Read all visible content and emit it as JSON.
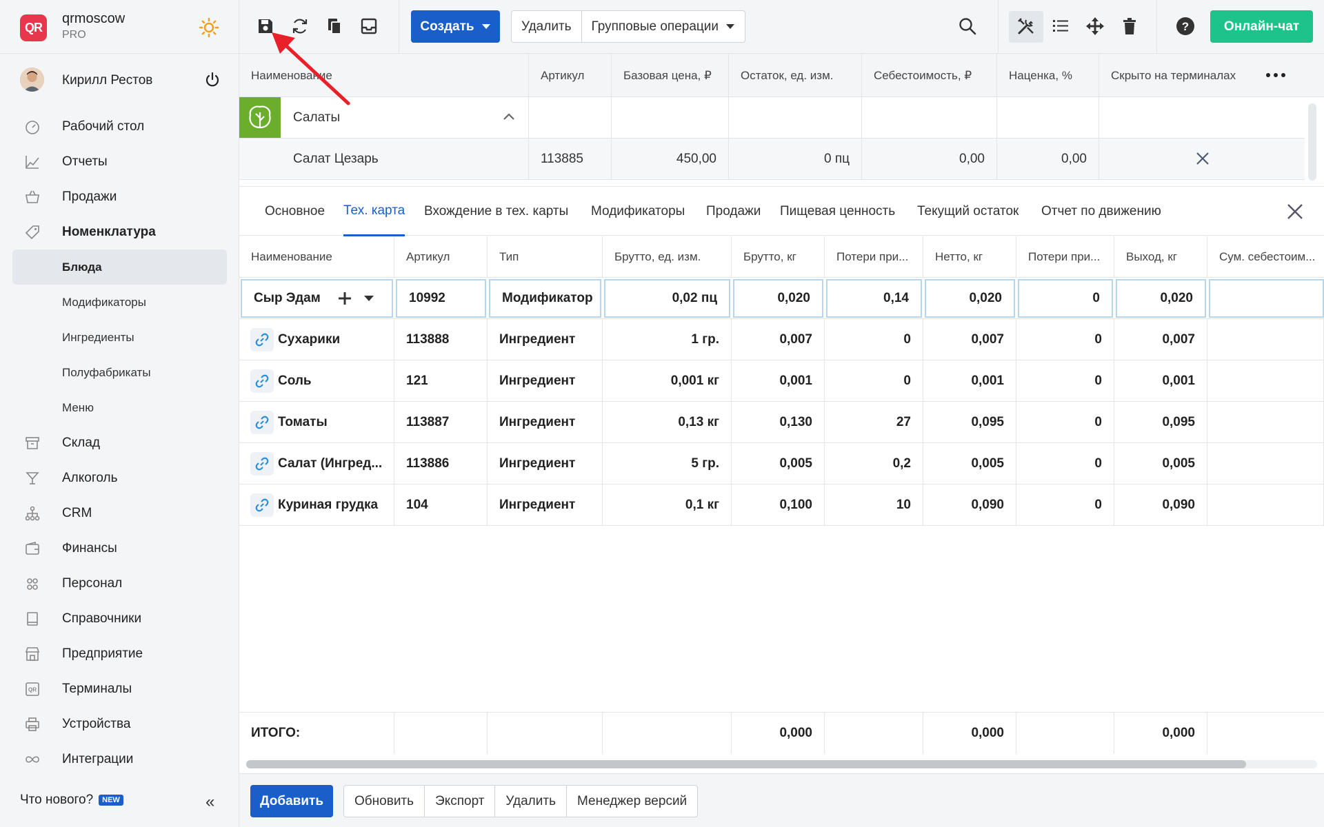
{
  "colors": {
    "accent": "#1a5fc9",
    "chat": "#1ec38b",
    "category": "#6aae2b",
    "logo": "#e8364c",
    "arrow": "#e8202a"
  },
  "brand": {
    "logo_text": "QR",
    "name": "qrmoscow",
    "plan": "PRO"
  },
  "user": {
    "name": "Кирилл Рестов"
  },
  "nav": {
    "items": [
      {
        "label": "Рабочий стол",
        "icon": "dashboard-icon"
      },
      {
        "label": "Отчеты",
        "icon": "chart-icon"
      },
      {
        "label": "Продажи",
        "icon": "basket-icon"
      },
      {
        "label": "Номенклатура",
        "icon": "tag-icon"
      },
      {
        "label": "Склад",
        "icon": "archive-icon"
      },
      {
        "label": "Алкоголь",
        "icon": "glass-icon"
      },
      {
        "label": "CRM",
        "icon": "hierarchy-icon"
      },
      {
        "label": "Финансы",
        "icon": "wallet-icon"
      },
      {
        "label": "Персонал",
        "icon": "people-icon"
      },
      {
        "label": "Справочники",
        "icon": "book-icon"
      },
      {
        "label": "Предприятие",
        "icon": "store-icon"
      },
      {
        "label": "Терминалы",
        "icon": "qr-icon"
      },
      {
        "label": "Устройства",
        "icon": "printer-icon"
      },
      {
        "label": "Интеграции",
        "icon": "infinity-icon"
      }
    ],
    "subitems": [
      "Блюда",
      "Модификаторы",
      "Ингредиенты",
      "Полуфабрикаты",
      "Меню"
    ],
    "whats_new": "Что нового?",
    "new_badge": "NEW"
  },
  "toolbar": {
    "create": "Создать",
    "delete": "Удалить",
    "group_ops": "Групповые операции",
    "chat": "Онлайн-чат"
  },
  "grid": {
    "headers": [
      "Наименование",
      "Артикул",
      "Базовая цена, ₽",
      "Остаток, ед. изм.",
      "Себестоимость, ₽",
      "Наценка, %",
      "Скрыто на терминалах"
    ],
    "category": "Салаты",
    "row": {
      "name": "Салат Цезарь",
      "article": "113885",
      "price": "450,00",
      "stock": "0 пц",
      "cost": "0,00",
      "markup": "0,00"
    }
  },
  "tabs": [
    "Основное",
    "Тех. карта",
    "Вхождение в тех. карты",
    "Модификаторы",
    "Продажи",
    "Пищевая ценность",
    "Текущий остаток",
    "Отчет по движению"
  ],
  "tech": {
    "headers": [
      "Наименование",
      "Артикул",
      "Тип",
      "Брутто, ед. изм.",
      "Брутто, кг",
      "Потери при...",
      "Нетто, кг",
      "Потери при...",
      "Выход, кг",
      "Сум. себестоим..."
    ],
    "edit_row": {
      "name": "Сыр Эдам",
      "article_ph": "10992",
      "type_ph": "Модификатор",
      "gross_unit": "0,02 пц",
      "gross_kg": "0,020",
      "loss1": "0,14",
      "net": "0,020",
      "loss2": "0",
      "yield": "0,020"
    },
    "rows": [
      {
        "name": "Сухарики",
        "article": "113888",
        "type": "Ингредиент",
        "gross_unit": "1 гр.",
        "gross_kg": "0,007",
        "loss1": "0",
        "net": "0,007",
        "loss2": "0",
        "yield": "0,007"
      },
      {
        "name": "Соль",
        "article": "121",
        "type": "Ингредиент",
        "gross_unit": "0,001 кг",
        "gross_kg": "0,001",
        "loss1": "0",
        "net": "0,001",
        "loss2": "0",
        "yield": "0,001"
      },
      {
        "name": "Томаты",
        "article": "113887",
        "type": "Ингредиент",
        "gross_unit": "0,13 кг",
        "gross_kg": "0,130",
        "loss1": "27",
        "net": "0,095",
        "loss2": "0",
        "yield": "0,095"
      },
      {
        "name": "Салат (Ингред...",
        "article": "113886",
        "type": "Ингредиент",
        "gross_unit": "5 гр.",
        "gross_kg": "0,005",
        "loss1": "0,2",
        "net": "0,005",
        "loss2": "0",
        "yield": "0,005"
      },
      {
        "name": "Куриная грудка",
        "article": "104",
        "type": "Ингредиент",
        "gross_unit": "0,1 кг",
        "gross_kg": "0,100",
        "loss1": "10",
        "net": "0,090",
        "loss2": "0",
        "yield": "0,090"
      }
    ],
    "total_label": "ИТОГО:",
    "total_gross_kg": "0,000",
    "total_net": "0,000",
    "total_yield": "0,000"
  },
  "bottom": {
    "add": "Добавить",
    "refresh": "Обновить",
    "export": "Экспорт",
    "delete": "Удалить",
    "versions": "Менеджер версий"
  }
}
